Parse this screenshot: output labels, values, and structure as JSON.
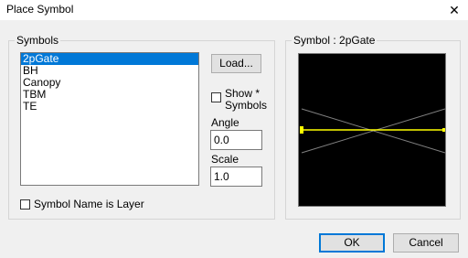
{
  "window": {
    "title": "Place Symbol",
    "close_glyph": "✕"
  },
  "symbols_group": {
    "label": "Symbols"
  },
  "symbol_list": [
    "2pGate",
    "BH",
    "Canopy",
    "TBM",
    "TE"
  ],
  "selected_index": 0,
  "load_button": "Load...",
  "show_symbols": {
    "line1": "Show *",
    "line2": "Symbols",
    "checked": false
  },
  "angle": {
    "label": "Angle",
    "value": "0.0"
  },
  "scale": {
    "label": "Scale",
    "value": "1.0"
  },
  "layer_option": {
    "label": "Symbol Name is Layer",
    "checked": false
  },
  "preview_group": {
    "label": "Symbol : 2pGate"
  },
  "buttons": {
    "ok": "OK",
    "cancel": "Cancel"
  },
  "colors": {
    "preview_bg": "#000000",
    "symbol_line": "#ffff00",
    "ghost_line": "#808080",
    "selection": "#0078d7"
  }
}
